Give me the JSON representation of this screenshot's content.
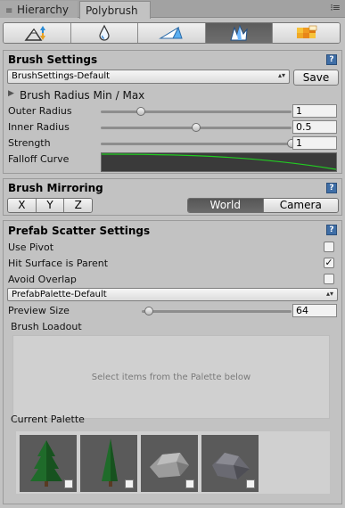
{
  "tabs": [
    {
      "label": "Hierarchy",
      "icon": "hierarchy-icon"
    },
    {
      "label": "Polybrush",
      "icon": ""
    }
  ],
  "tab_menu_icon": "menu-icon",
  "modes": [
    {
      "name": "raise-lower-mode",
      "icon": "mountain-arrows-icon"
    },
    {
      "name": "smooth-mode",
      "icon": "drop-icon"
    },
    {
      "name": "texture-mode",
      "icon": "prism-icon"
    },
    {
      "name": "scatter-prefabs-mode",
      "icon": "shape-icon",
      "selected": true
    },
    {
      "name": "color-mode",
      "icon": "color-grid-icon"
    }
  ],
  "brush_settings": {
    "title": "Brush Settings",
    "preset": "BrushSettings-Default",
    "save_label": "Save",
    "radius_minmax_label": "Brush Radius Min / Max",
    "outer_radius": {
      "label": "Outer Radius",
      "value": "1",
      "fraction": 0.21
    },
    "inner_radius": {
      "label": "Inner Radius",
      "value": "0.5",
      "fraction": 0.5
    },
    "strength": {
      "label": "Strength",
      "value": "1",
      "fraction": 1.0
    },
    "falloff_label": "Falloff Curve",
    "curve_color": "#22cc22"
  },
  "brush_mirroring": {
    "title": "Brush Mirroring",
    "axes": [
      "X",
      "Y",
      "Z"
    ],
    "space_options": [
      "World",
      "Camera"
    ],
    "selected_space": "World"
  },
  "prefab_scatter": {
    "title": "Prefab Scatter Settings",
    "use_pivot": {
      "label": "Use Pivot",
      "checked": false
    },
    "hit_surface": {
      "label": "Hit Surface is Parent",
      "checked": true
    },
    "avoid_overlap": {
      "label": "Avoid Overlap",
      "checked": false
    },
    "palette_preset": "PrefabPalette-Default",
    "preview_size": {
      "label": "Preview Size",
      "value": "64",
      "fraction": 0.05
    },
    "loadout_label": "Brush Loadout",
    "loadout_empty": "Select items from the Palette below",
    "current_palette_label": "Current Palette",
    "palette_items": [
      "pine-tree",
      "cypress-tree",
      "rock-light",
      "rock-dark"
    ]
  },
  "help_icon_text": "?",
  "check_mark": "✓",
  "colors": {
    "accent": "#3f6ea6",
    "background": "#c2c2c2",
    "selected_mode": "#5c5c5c"
  }
}
